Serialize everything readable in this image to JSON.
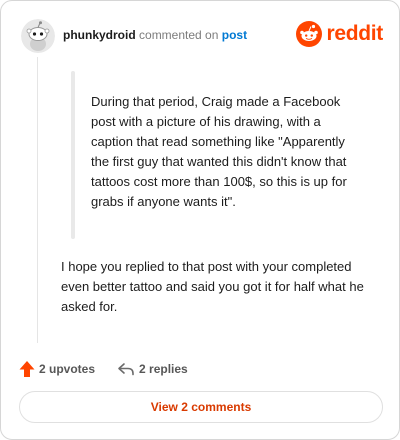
{
  "header": {
    "username": "phunkydroid",
    "action": "commented on",
    "post_link": "post",
    "brand": "reddit"
  },
  "comment": {
    "quote": "During that period, Craig made a Facebook post with a picture of his drawing, with a caption that read something like \"Apparently the first guy that wanted this didn't know that tattoos cost more than 100$, so this is up for grabs if anyone wants it\".",
    "reply": "I hope you replied to that post with your completed even better tattoo and said you got it for half what he asked for."
  },
  "footer": {
    "upvotes": "2 upvotes",
    "replies": "2 replies",
    "view_button": "View 2 comments"
  },
  "colors": {
    "brand": "#ff4500",
    "link": "#0079d3",
    "upvote": "#ff4500",
    "button_text": "#d93a00"
  },
  "icons": {
    "avatar": "snoo-avatar-icon",
    "brand_logo": "reddit-logo-icon",
    "upvote": "upvote-arrow-icon",
    "reply": "reply-arrow-icon"
  }
}
